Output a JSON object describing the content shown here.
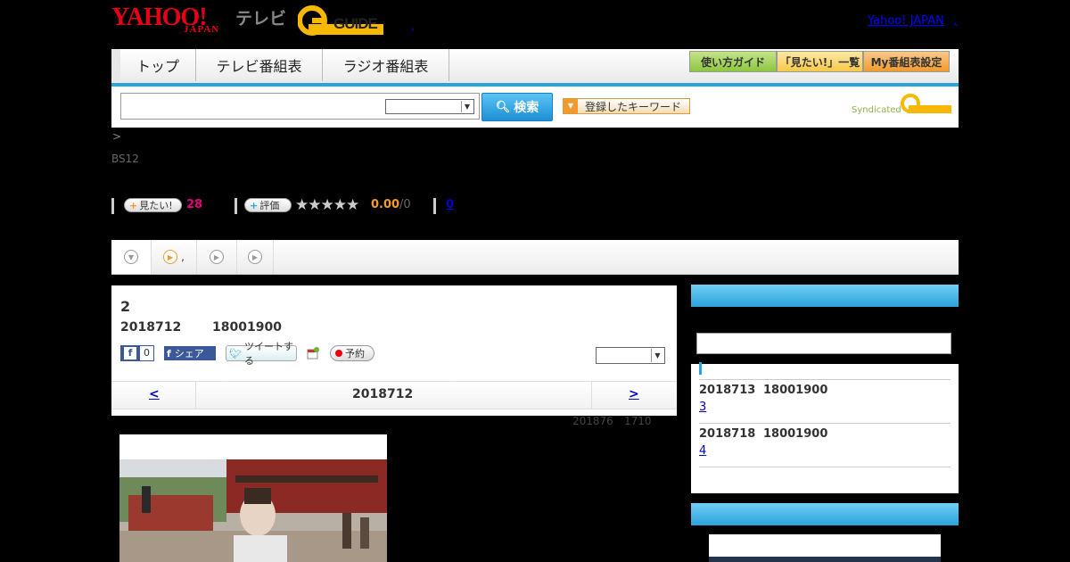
{
  "header": {
    "logo_yahoo": "YAHOO!",
    "logo_japan": "JAPAN",
    "logo_tv": "テレビ",
    "logo_gguide": "GUIDE",
    "yahoo_japan_link": "Yahoo! JAPAN",
    "link_sep": ",",
    "small_link": ","
  },
  "nav": {
    "tabs": [
      "トップ",
      "テレビ番組表",
      "ラジオ番組表"
    ],
    "buttons": [
      {
        "label": "使い方ガイド",
        "color": "#8dc63f"
      },
      {
        "label": "「見たい!」一覧",
        "color": "#f7c94b"
      },
      {
        "label": "My番組表設定",
        "color": "#f39a2e"
      }
    ],
    "accent": "#29a4dc"
  },
  "search": {
    "placeholder": "",
    "select_value": "",
    "button_label": "検索",
    "keyword_label": "登録したキーワード",
    "syndicated": "Syndicated"
  },
  "breadcrumb": ">",
  "channel": "BS12",
  "stats": {
    "mitai_label": "見たい!",
    "mitai_count": "28",
    "rate_label": "評価",
    "rating": "0.00",
    "rating_suffix": "/0",
    "reviews": "0",
    "stars": "★★★★★"
  },
  "subtabs": {
    "tab2_text": ","
  },
  "program": {
    "episode": "2",
    "date": "2018712",
    "time": "18001900",
    "like_count": "0",
    "share_label": "シェア",
    "tweet_label": "ツイートする",
    "reserve_label": "予約",
    "select_value": "",
    "prev": "<",
    "next": ">",
    "nav_date": "2018712",
    "updated_date": "201876",
    "updated_time": "1710"
  },
  "sidebar": {
    "items": [
      {
        "date": "2018713",
        "time": "18001900",
        "link": "3"
      },
      {
        "date": "2018718",
        "time": "18001900",
        "link": "4"
      }
    ]
  }
}
